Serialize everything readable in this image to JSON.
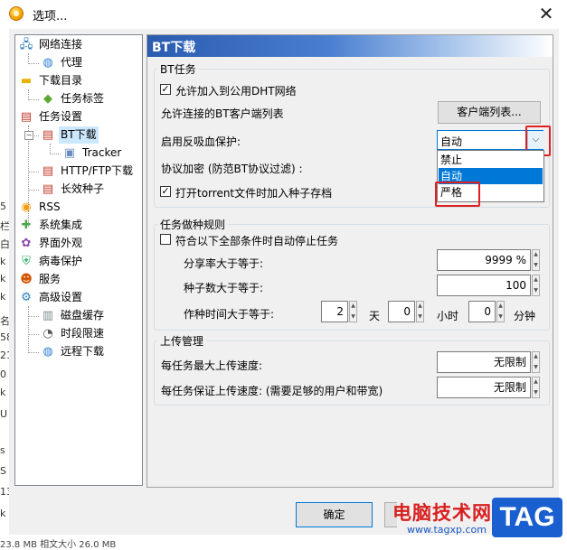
{
  "window": {
    "title": "选项...",
    "close": "✕"
  },
  "background_fragments": [
    "5",
    "栏",
    "白",
    "k",
    "k",
    "k",
    "名",
    "58",
    "21",
    "0",
    "k",
    "U",
    "s",
    "S",
    "13",
    "k"
  ],
  "status_bar": "23.8 MB   相文大小   26.0 MB",
  "tree": {
    "items": [
      {
        "label": "网络连接",
        "icon": "network-icon"
      },
      {
        "label": "代理",
        "icon": "globe-icon"
      },
      {
        "label": "下载目录",
        "icon": "folder-icon"
      },
      {
        "label": "任务标签",
        "icon": "tag-icon"
      },
      {
        "label": "任务设置",
        "icon": "clipboard-icon"
      },
      {
        "label": "BT下载",
        "icon": "clipboard-icon"
      },
      {
        "label": "Tracker",
        "icon": "cube-icon"
      },
      {
        "label": "HTTP/FTP下载",
        "icon": "clipboard-icon"
      },
      {
        "label": "长效种子",
        "icon": "clipboard-icon"
      },
      {
        "label": "RSS",
        "icon": "rss-icon"
      },
      {
        "label": "系统集成",
        "icon": "puzzle-icon"
      },
      {
        "label": "界面外观",
        "icon": "palette-icon"
      },
      {
        "label": "病毒保护",
        "icon": "shield-icon"
      },
      {
        "label": "服务",
        "icon": "users-icon"
      },
      {
        "label": "高级设置",
        "icon": "settings-icon"
      },
      {
        "label": "磁盘缓存",
        "icon": "disk-icon"
      },
      {
        "label": "时段限速",
        "icon": "speed-icon"
      },
      {
        "label": "远程下载",
        "icon": "globe-icon"
      }
    ]
  },
  "panel": {
    "title": "BT下载",
    "bt_task": {
      "group_title": "BT任务",
      "dht_label": "允许加入到公用DHT网络",
      "dht_checked": true,
      "client_list_label": "允许连接的BT客户端列表",
      "client_list_button": "客户端列表...",
      "anti_leech_label": "启用反吸血保护:",
      "anti_leech_value": "自动",
      "anti_leech_options": [
        "禁止",
        "自动",
        "严格"
      ],
      "anti_leech_highlighted": "自动",
      "protocol_label": "协议加密 (防范BT协议过滤) :",
      "torrent_label": "打开torrent文件时加入种子存档",
      "torrent_checked": true
    },
    "seeding": {
      "group_title": "任务做种规则",
      "auto_stop_label": "符合以下全部条件时自动停止任务",
      "auto_stop_checked": false,
      "ratio_label": "分享率大于等于:",
      "ratio_value": "9999 %",
      "seeds_label": "种子数大于等于:",
      "seeds_value": "100",
      "time_label": "作种时间大于等于:",
      "days_value": "2",
      "days_unit": "天",
      "hours_value": "0",
      "hours_unit": "小时",
      "minutes_value": "0",
      "minutes_unit": "分钟"
    },
    "upload": {
      "group_title": "上传管理",
      "max_label": "每任务最大上传速度:",
      "max_value": "无限制",
      "min_label": "每任务保证上传速度: (需要足够的用户和带宽)",
      "min_value": "无限制"
    }
  },
  "footer": {
    "ok_label": "确定"
  },
  "watermark": {
    "text": "电脑技术网",
    "url": "www.tagxp.com",
    "tag": "TAG"
  },
  "colors": {
    "header_start": "#2a5bb0",
    "selection": "#0078d7",
    "highlight_red": "#e02020"
  }
}
